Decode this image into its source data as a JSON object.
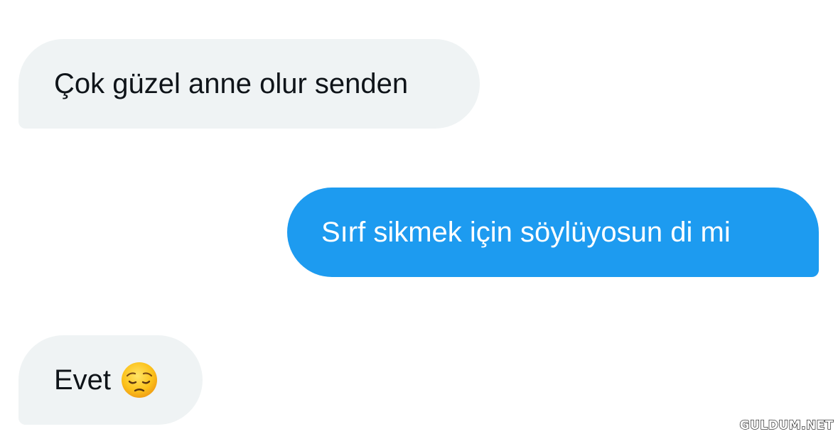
{
  "conversation": {
    "messages": [
      {
        "direction": "received",
        "text": "Çok güzel anne olur senden"
      },
      {
        "direction": "sent",
        "text": "Sırf sikmek için söylüyosun di mi"
      },
      {
        "direction": "received",
        "text": "Evet",
        "emoji": "pensive-face-icon"
      }
    ]
  },
  "colors": {
    "received_bubble": "#eff3f4",
    "received_text": "#0f1419",
    "sent_bubble": "#1d9bf0",
    "sent_text": "#ffffff",
    "background": "#ffffff"
  },
  "watermark": {
    "text": "GULDUM.NET"
  }
}
